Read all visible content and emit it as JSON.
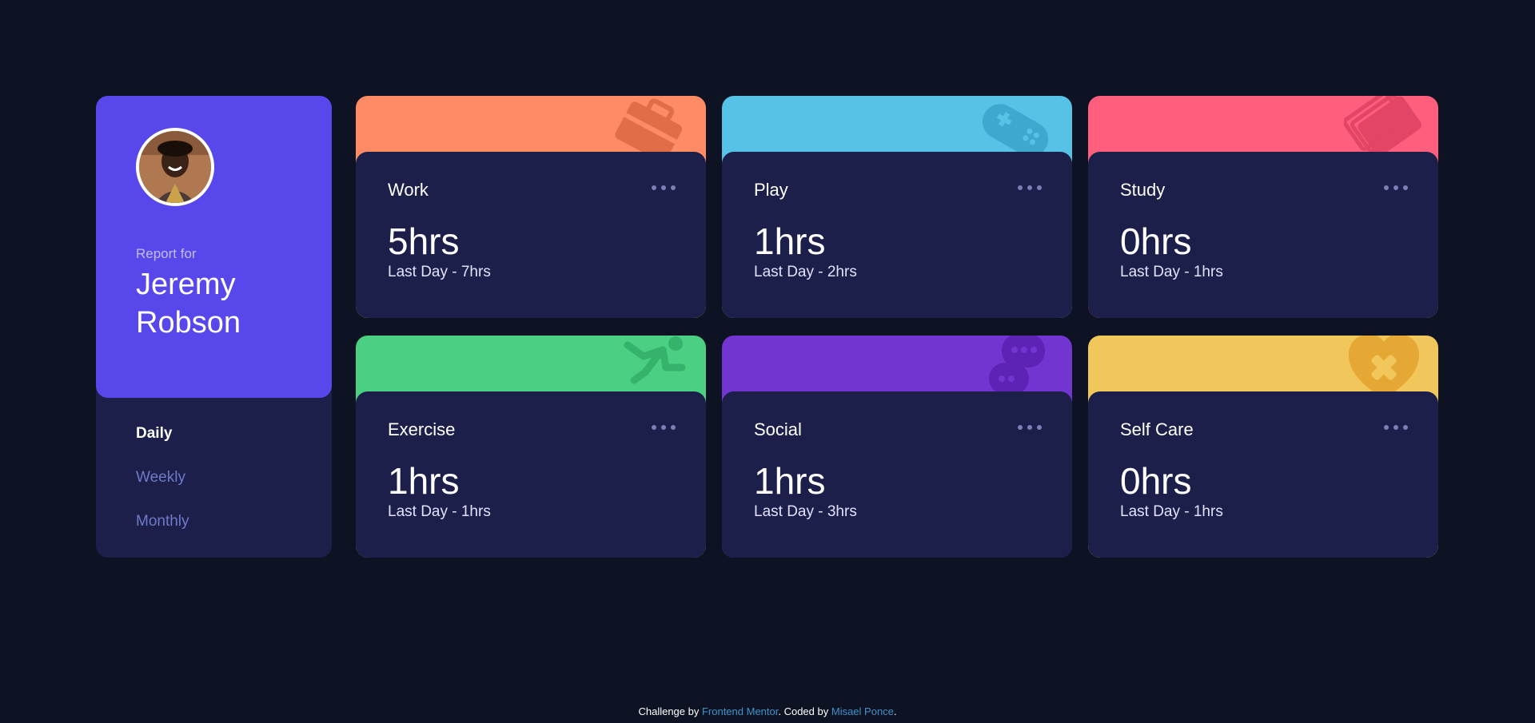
{
  "profile": {
    "report_for": "Report for",
    "name": "Jeremy Robson",
    "periods": [
      "Daily",
      "Weekly",
      "Monthly"
    ],
    "active_period": "Daily"
  },
  "cards": [
    {
      "title": "Work",
      "hours": "5hrs",
      "previous": "Last Day - 7hrs",
      "color": "#ff8b64",
      "icon": "briefcase-icon"
    },
    {
      "title": "Play",
      "hours": "1hrs",
      "previous": "Last Day - 2hrs",
      "color": "#55c2e6",
      "icon": "gamepad-icon"
    },
    {
      "title": "Study",
      "hours": "0hrs",
      "previous": "Last Day - 1hrs",
      "color": "#ff5e7d",
      "icon": "book-icon"
    },
    {
      "title": "Exercise",
      "hours": "1hrs",
      "previous": "Last Day - 1hrs",
      "color": "#4bcf82",
      "icon": "running-icon"
    },
    {
      "title": "Social",
      "hours": "1hrs",
      "previous": "Last Day - 3hrs",
      "color": "#7335d2",
      "icon": "chat-icon"
    },
    {
      "title": "Self Care",
      "hours": "0hrs",
      "previous": "Last Day - 1hrs",
      "color": "#f1c75b",
      "icon": "heart-icon"
    }
  ],
  "footer": {
    "prefix": "Challenge by ",
    "challenge_link": "Frontend Mentor",
    "middle": ". Coded by ",
    "author_link": "Misael Ponce",
    "suffix": "."
  },
  "colors": {
    "background": "#0e1323",
    "card_body": "#1c1f4a",
    "profile_accent": "#5847eb"
  }
}
